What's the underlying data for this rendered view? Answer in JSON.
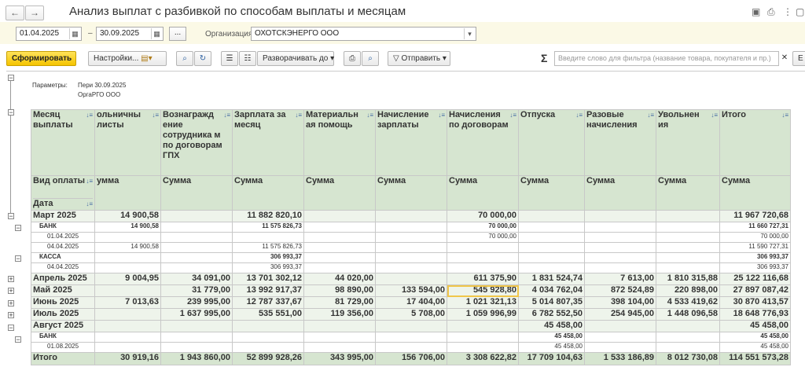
{
  "window": {
    "title": "Анализ выплат с разбивкой по способам выплаты и месяцам"
  },
  "params": {
    "date_from": "01.04.2025",
    "date_sep": "–",
    "date_to": "30.09.2025",
    "more_btn": "...",
    "org_label": "Организация:",
    "org_value": "ОХОТСКЭНЕРГО ООО"
  },
  "toolbar": {
    "generate": "Сформировать",
    "settings": "Настройки...",
    "expand_to": "Разворачивать до",
    "send": "Отправить",
    "sigma": "Σ",
    "filter_placeholder": "Введите слово для фильтра (название товара, покупателя и пр.)",
    "more": "Е"
  },
  "report_params": {
    "label": "Параметры:",
    "line1_key": "Пери",
    "line1_val": "30.09.2025",
    "line2_key": "Орга",
    "line2_val": "РГО ООО"
  },
  "table": {
    "headers": [
      "Месяц выплаты",
      "ольничны листы",
      "Вознагражд ение сотрудника м по договорам ГПХ",
      "Зарплата за месяц",
      "Материальн ая помощь",
      "Начисление зарплаты",
      "Начисления по договорам",
      "Отпуска",
      "Разовые начисления",
      "Увольнен ия",
      "Итого"
    ],
    "sub_headers": [
      "Вид оплаты",
      "уммa",
      "Сумма",
      "Сумма",
      "Сумма",
      "Сумма",
      "Сумма",
      "Сумма",
      "Сумма",
      "Сумма",
      "Сумма"
    ],
    "date_label": "Дата",
    "rows": [
      {
        "level": 1,
        "cells": [
          "Март 2025",
          "14 900,58",
          "",
          "11 882 820,10",
          "",
          "",
          "70 000,00",
          "",
          "",
          "",
          "11 967 720,68"
        ]
      },
      {
        "level": 2,
        "cells": [
          "БАНК",
          "14 900,58",
          "",
          "11 575 826,73",
          "",
          "",
          "70 000,00",
          "",
          "",
          "",
          "11 660 727,31"
        ]
      },
      {
        "level": 3,
        "cells": [
          "01.04.2025",
          "",
          "",
          "",
          "",
          "",
          "70 000,00",
          "",
          "",
          "",
          "70 000,00"
        ]
      },
      {
        "level": 3,
        "cells": [
          "04.04.2025",
          "14 900,58",
          "",
          "11 575 826,73",
          "",
          "",
          "",
          "",
          "",
          "",
          "11 590 727,31"
        ]
      },
      {
        "level": 2,
        "cells": [
          "КАССА",
          "",
          "",
          "306 993,37",
          "",
          "",
          "",
          "",
          "",
          "",
          "306 993,37"
        ]
      },
      {
        "level": 3,
        "cells": [
          "04.04.2025",
          "",
          "",
          "306 993,37",
          "",
          "",
          "",
          "",
          "",
          "",
          "306 993,37"
        ]
      },
      {
        "level": 1,
        "cells": [
          "Апрель 2025",
          "9 004,95",
          "34 091,00",
          "13 701 302,12",
          "44 020,00",
          "",
          "611 375,90",
          "1 831 524,74",
          "7 613,00",
          "1 810 315,88",
          "25 122 116,68"
        ]
      },
      {
        "level": 1,
        "cells": [
          "Май 2025",
          "",
          "31 779,00",
          "13 992 917,37",
          "98 890,00",
          "133 594,00",
          "545 928,80",
          "4 034 762,04",
          "872 524,89",
          "220 898,00",
          "27 897 087,42"
        ]
      },
      {
        "level": 1,
        "cells": [
          "Июнь 2025",
          "7 013,63",
          "239 995,00",
          "12 787 337,67",
          "81 729,00",
          "17 404,00",
          "1 021 321,13",
          "5 014 807,35",
          "398 104,00",
          "4 533 419,62",
          "30 870 413,57"
        ]
      },
      {
        "level": 1,
        "cells": [
          "Июль 2025",
          "",
          "1 637 995,00",
          "535 551,00",
          "119 356,00",
          "5 708,00",
          "1 059 996,99",
          "6 782 552,50",
          "254 945,00",
          "1 448 096,58",
          "18 648 776,93"
        ]
      },
      {
        "level": 1,
        "cells": [
          "Август 2025",
          "",
          "",
          "",
          "",
          "",
          "",
          "45 458,00",
          "",
          "",
          "45 458,00"
        ]
      },
      {
        "level": 2,
        "cells": [
          "БАНК",
          "",
          "",
          "",
          "",
          "",
          "",
          "45 458,00",
          "",
          "",
          "45 458,00"
        ]
      },
      {
        "level": 3,
        "cells": [
          "01.08.2025",
          "",
          "",
          "",
          "",
          "",
          "",
          "45 458,00",
          "",
          "",
          "45 458,00"
        ]
      },
      {
        "level": 0,
        "cells": [
          "Итого",
          "30 919,16",
          "1 943 860,00",
          "52 899 928,26",
          "343 995,00",
          "156 706,00",
          "3 308 622,82",
          "17 709 104,63",
          "1 533 186,89",
          "8 012 730,08",
          "114 551 573,28"
        ]
      }
    ]
  }
}
